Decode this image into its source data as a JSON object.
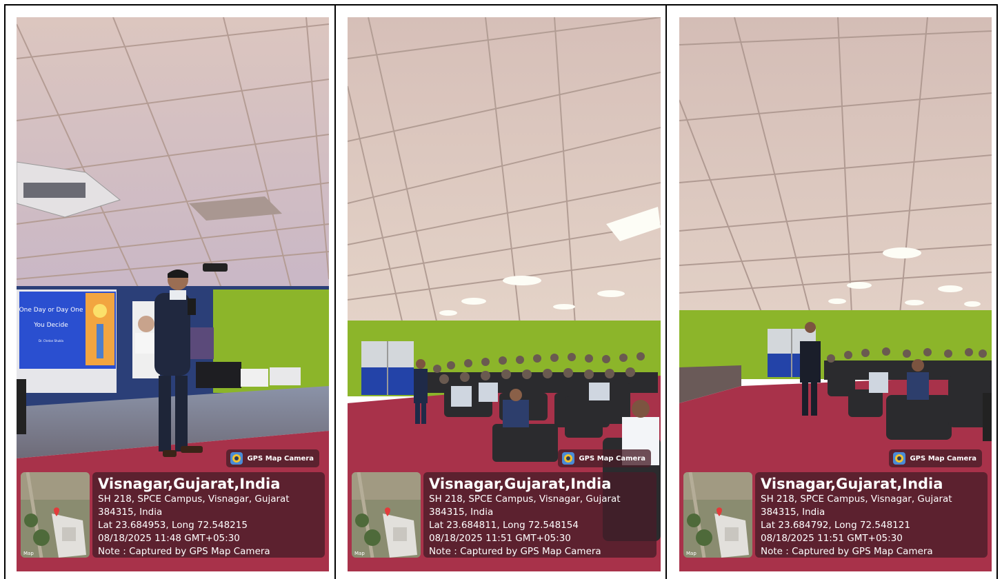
{
  "panels": [
    {
      "gps_app_label": "GPS Map Camera",
      "location_title": "Visnagar,Gujarat,India",
      "address_line1": "SH 218, SPCE Campus, Visnagar, Gujarat",
      "address_line2": "384315, India",
      "coordinates": "Lat 23.684953, Long 72.548215",
      "timestamp": "08/18/2025 11:48 GMT+05:30",
      "note": "Note : Captured by GPS Map Camera",
      "map_label": "Map",
      "slide": {
        "title_line1": "One Day or Day One",
        "title_line2": "You Decide",
        "presenter": "Dr. Chetan Shukla"
      }
    },
    {
      "gps_app_label": "GPS Map Camera",
      "location_title": "Visnagar,Gujarat,India",
      "address_line1": "SH 218, SPCE Campus, Visnagar, Gujarat",
      "address_line2": "384315, India",
      "coordinates": "Lat 23.684811, Long 72.548154",
      "timestamp": "08/18/2025 11:51 GMT+05:30",
      "note": "Note : Captured by GPS Map Camera",
      "map_label": "Map"
    },
    {
      "gps_app_label": "GPS Map Camera",
      "location_title": "Visnagar,Gujarat,India",
      "address_line1": "SH 218, SPCE Campus, Visnagar, Gujarat",
      "address_line2": "384315, India",
      "coordinates": "Lat 23.684792, Long 72.548121",
      "timestamp": "08/18/2025 11:51 GMT+05:30",
      "note": "Note : Captured by GPS Map Camera",
      "map_label": "Map"
    }
  ],
  "colors": {
    "info_box_bg": "#461c28",
    "ceiling": "#d9c3bc",
    "wall_green": "#8cb52a",
    "carpet": "#a8324a",
    "seat": "#2b2b2e",
    "slide_blue": "#2a4fd0"
  }
}
